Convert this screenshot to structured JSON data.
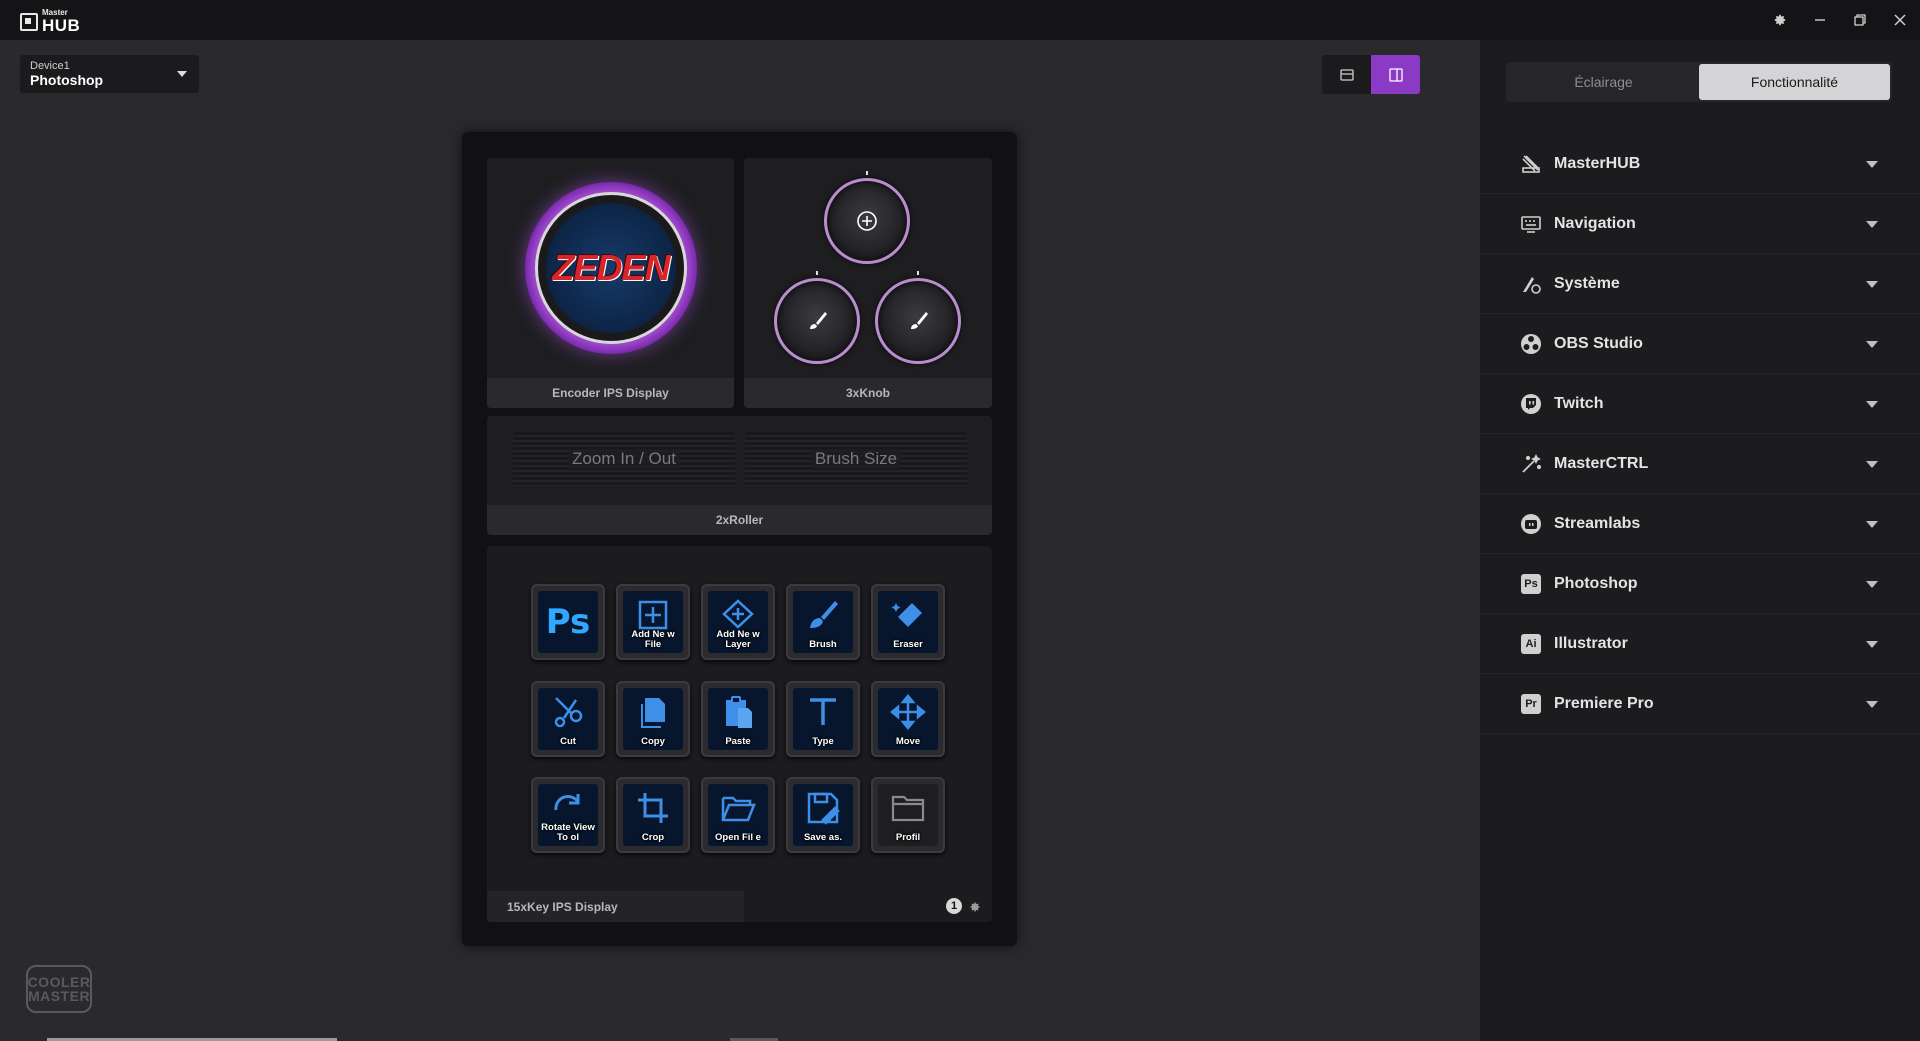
{
  "app": {
    "logo_small": "Master",
    "logo_big": "HUB"
  },
  "device": {
    "label": "Device1",
    "value": "Photoshop"
  },
  "modules": {
    "encoder_label": "Encoder IPS Display",
    "encoder_logo": "ZEDEN",
    "knobs_label": "3xKnob",
    "rollers_label": "2xRoller",
    "roller_left": "Zoom In / Out",
    "roller_right": "Brush Size",
    "keys_label": "15xKey IPS Display",
    "page_number": "1"
  },
  "keys": [
    {
      "label": "",
      "icon": "photoshop-logo"
    },
    {
      "label": "Add Ne w File",
      "icon": "add-file-icon"
    },
    {
      "label": "Add Ne w Layer",
      "icon": "add-layer-icon"
    },
    {
      "label": "Brush",
      "icon": "brush-icon"
    },
    {
      "label": "Eraser",
      "icon": "eraser-icon"
    },
    {
      "label": "Cut",
      "icon": "scissors-icon"
    },
    {
      "label": "Copy",
      "icon": "copy-icon"
    },
    {
      "label": "Paste",
      "icon": "paste-icon"
    },
    {
      "label": "Type",
      "icon": "type-icon"
    },
    {
      "label": "Move",
      "icon": "move-icon"
    },
    {
      "label": "Rotate View To ol",
      "icon": "rotate-icon"
    },
    {
      "label": "Crop",
      "icon": "crop-icon"
    },
    {
      "label": "Open Fil e",
      "icon": "open-folder-icon"
    },
    {
      "label": "Save as.",
      "icon": "save-icon"
    },
    {
      "label": "Profil",
      "icon": "folder-icon"
    }
  ],
  "sidebar": {
    "tabs": [
      "Éclairage",
      "Fonctionnalité"
    ],
    "active_tab": 1,
    "categories": [
      {
        "label": "MasterHUB",
        "icon": "masterhub-icon"
      },
      {
        "label": "Navigation",
        "icon": "keyboard-icon"
      },
      {
        "label": "Système",
        "icon": "system-icon"
      },
      {
        "label": "OBS Studio",
        "icon": "obs-icon"
      },
      {
        "label": "Twitch",
        "icon": "twitch-icon"
      },
      {
        "label": "MasterCTRL",
        "icon": "masterctrl-icon"
      },
      {
        "label": "Streamlabs",
        "icon": "streamlabs-icon"
      },
      {
        "label": "Photoshop",
        "badge": "Ps"
      },
      {
        "label": "Illustrator",
        "badge": "Ai"
      },
      {
        "label": "Premiere Pro",
        "badge": "Pr"
      }
    ]
  },
  "brand": {
    "line1": "COOLER",
    "line2": "MASTER"
  },
  "colors": {
    "accent": "#8a3ac4",
    "key_icon": "#3d8fe8",
    "ring": "#c06ae8"
  }
}
